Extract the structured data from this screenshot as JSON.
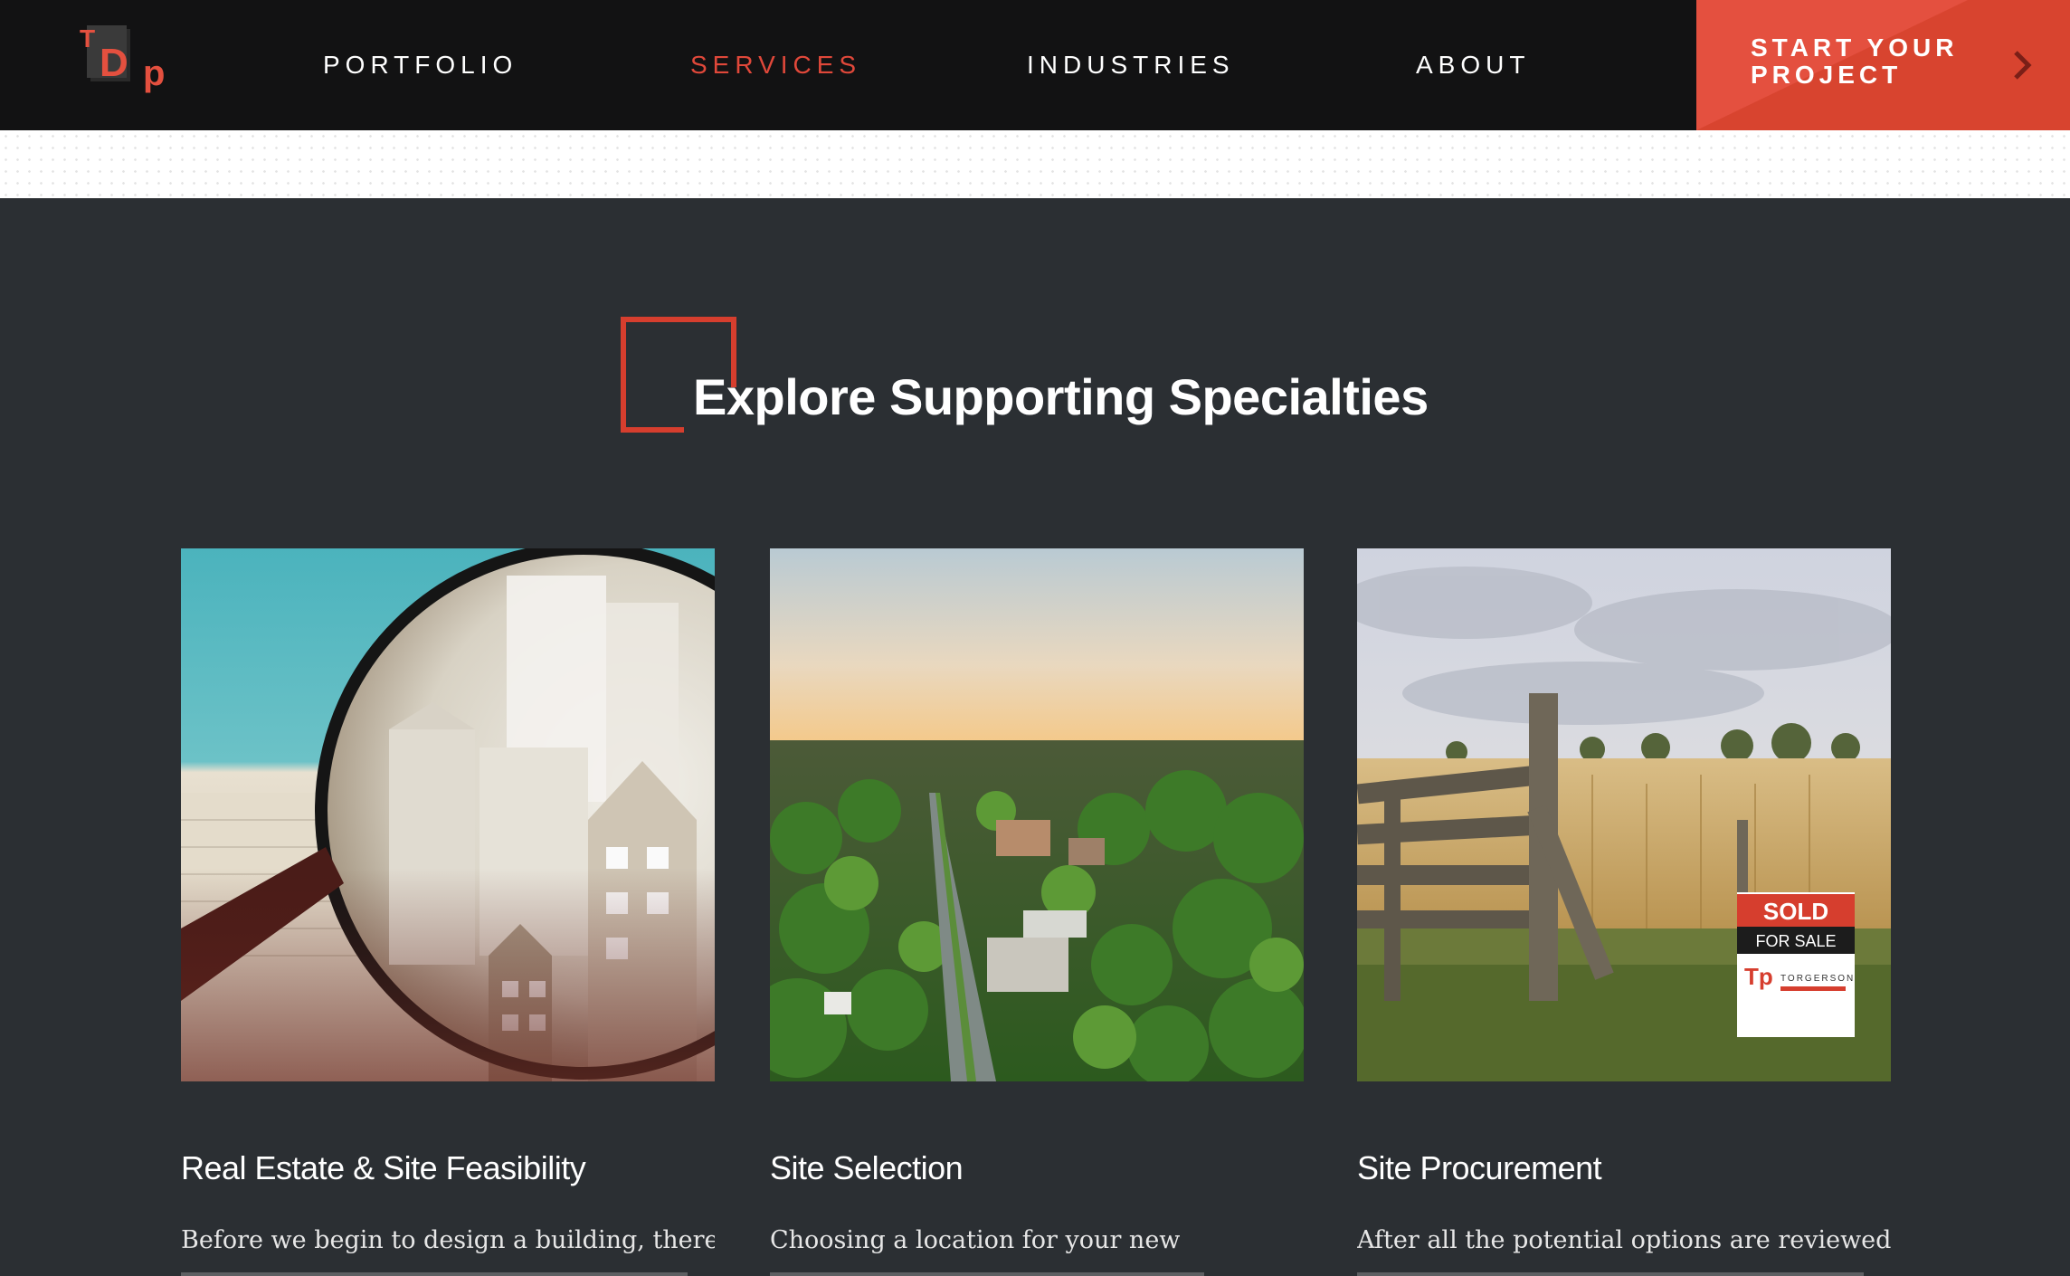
{
  "nav": {
    "logo_text": "TDp",
    "links": [
      {
        "label": "PORTFOLIO",
        "active": false
      },
      {
        "label": "SERVICES",
        "active": true
      },
      {
        "label": "INDUSTRIES",
        "active": false
      },
      {
        "label": "ABOUT",
        "active": false
      }
    ],
    "cta_label": "START YOUR PROJECT",
    "cta_arrow_icon": "chevron-right-icon"
  },
  "section": {
    "heading": "Explore Supporting Specialties"
  },
  "cards": [
    {
      "title": "Real Estate & Site Feasibility",
      "text": "Before we begin to design a building, there",
      "image": "magnifying-glass-paper-houses"
    },
    {
      "title": "Site Selection",
      "text": "Choosing a location for your new",
      "image": "aerial-small-town"
    },
    {
      "title": "Site Procurement",
      "text": "After all the potential options are reviewed,",
      "image": "wheat-field-sold-sign",
      "sign_sold": "SOLD",
      "sign_for_sale": "FOR SALE",
      "sign_company": "TORGERSON"
    }
  ],
  "colors": {
    "accent": "#e4503f",
    "nav_bg": "#121213",
    "page_bg": "#2b2f33"
  }
}
